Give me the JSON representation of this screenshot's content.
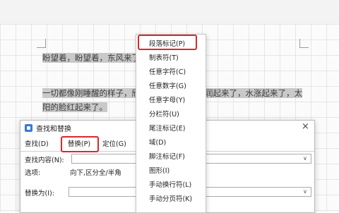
{
  "document": {
    "line1": "盼望着，盼望着，东风来了",
    "line2_left": "一切都像刚睡醒的样子，欣",
    "line2_right": "润起来了，水涨起来了，太",
    "line3": "阳的脸红起来了。"
  },
  "menu": {
    "items": [
      {
        "label": "段落标记(P)"
      },
      {
        "label": "制表符(T)"
      },
      {
        "label": "任意字符(C)"
      },
      {
        "label": "任意数字(G)"
      },
      {
        "label": "任意字母(Y)"
      },
      {
        "label": "分栏符(U)"
      },
      {
        "label": "尾注标记(E)"
      },
      {
        "label": "域(D)"
      },
      {
        "label": "脚注标记(F)"
      },
      {
        "label": "图形(I)"
      },
      {
        "label": "手动换行符(L)"
      },
      {
        "label": "手动分页符(K)"
      }
    ]
  },
  "dialog": {
    "title": "查找和替换",
    "close_icon": "×",
    "tabs": {
      "find": "查找(D)",
      "replace": "替换(P)",
      "goto": "定位(G)"
    },
    "find_label": "查找内容(N):",
    "options_label": "选项:",
    "options_value": "向下,区分全/半角",
    "replace_label": "替换为(I):",
    "dropdown_arrow": "∨"
  },
  "colors": {
    "highlight_red": "#d9282f",
    "selection_gray": "#c9c9c9"
  }
}
